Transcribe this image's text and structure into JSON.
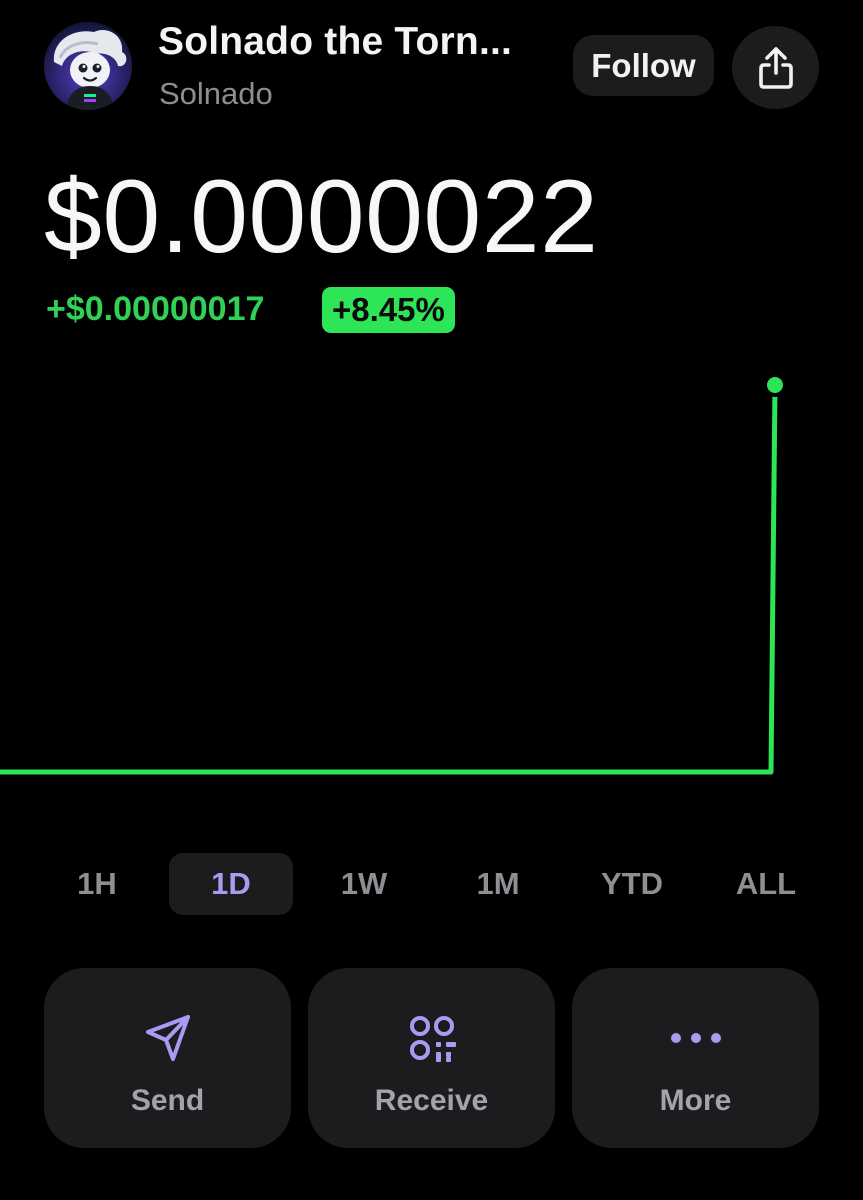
{
  "header": {
    "token_name": "Solnado the Torn...",
    "token_symbol": "Solnado",
    "follow_label": "Follow",
    "share_icon": "share-icon",
    "avatar_icon": "tornado-avatar"
  },
  "price": {
    "value": "$0.0000022",
    "change_abs": "+$0.00000017",
    "change_pct": "+8.45%"
  },
  "colors": {
    "positive": "#2ee557",
    "accent_purple": "#a79cf2",
    "surface": "#1c1c1e",
    "background": "#000000"
  },
  "chart_data": {
    "type": "line",
    "title": "",
    "xlabel": "",
    "ylabel": "",
    "series": [
      {
        "values": [
          0,
          0,
          0,
          0,
          0,
          0,
          0,
          0,
          0,
          0,
          0,
          0,
          1
        ]
      }
    ],
    "grid": false
  },
  "ranges": {
    "selected": "1D",
    "items": [
      "1H",
      "1D",
      "1W",
      "1M",
      "YTD",
      "ALL"
    ]
  },
  "actions": [
    {
      "label": "Send",
      "icon": "send-icon"
    },
    {
      "label": "Receive",
      "icon": "qr-code-icon"
    },
    {
      "label": "More",
      "icon": "more-dots-icon"
    }
  ]
}
